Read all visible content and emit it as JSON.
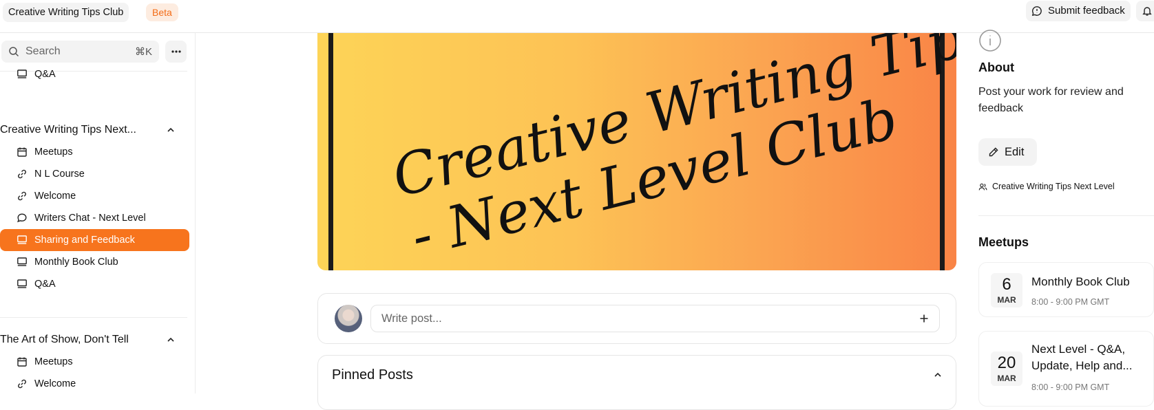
{
  "topbar": {
    "club_name": "Creative Writing Tips Club",
    "beta_label": "Beta",
    "feedback_label": "Submit feedback"
  },
  "sidebar": {
    "search_placeholder": "Search",
    "search_shortcut": "⌘K",
    "top_item": {
      "label": "Q&A",
      "icon": "presentation-icon"
    },
    "groups": [
      {
        "title": "Creative Writing Tips Next...",
        "items": [
          {
            "label": "Meetups",
            "icon": "calendar-icon"
          },
          {
            "label": "N L Course",
            "icon": "link-icon"
          },
          {
            "label": "Welcome",
            "icon": "link-icon"
          },
          {
            "label": "Writers Chat - Next Level",
            "icon": "chat-icon"
          },
          {
            "label": "Sharing and Feedback",
            "icon": "presentation-icon",
            "active": true
          },
          {
            "label": "Monthly Book Club",
            "icon": "presentation-icon"
          },
          {
            "label": "Q&A",
            "icon": "presentation-icon"
          }
        ]
      },
      {
        "title": "The Art of Show, Don't Tell",
        "items": [
          {
            "label": "Meetups",
            "icon": "calendar-icon"
          },
          {
            "label": "Welcome",
            "icon": "link-icon"
          }
        ]
      }
    ]
  },
  "main": {
    "banner_line1": "Creative Writing Tips",
    "banner_line2": "- Next Level Club",
    "post_placeholder": "Write post...",
    "pinned_title": "Pinned Posts"
  },
  "right": {
    "about_title": "About",
    "about_desc": "Post your work for review and feedback",
    "edit_label": "Edit",
    "community_label": "Creative Writing Tips Next Level",
    "meetups_title": "Meetups",
    "meetups": [
      {
        "day": "6",
        "month": "MAR",
        "title": "Monthly Book Club",
        "time": "8:00 - 9:00 PM GMT"
      },
      {
        "day": "20",
        "month": "MAR",
        "title": "Next Level - Q&A, Update, Help and...",
        "time": "8:00 - 9:00 PM GMT"
      }
    ]
  },
  "colors": {
    "accent": "#f7741d",
    "beta_text": "#f36c17",
    "banner_start": "#fdd457",
    "banner_end": "#f98446"
  }
}
